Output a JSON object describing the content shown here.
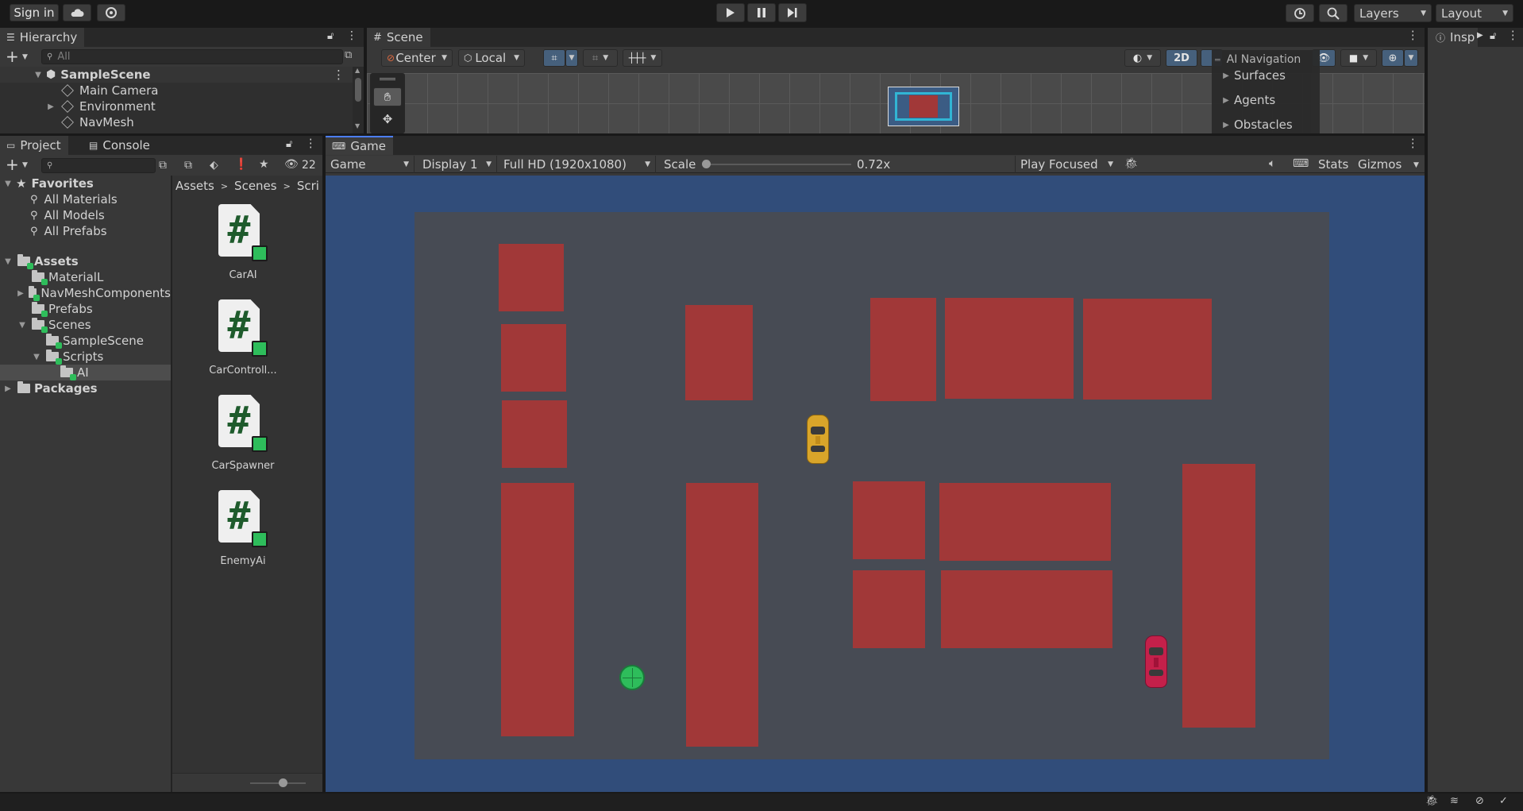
{
  "topbar": {
    "sign_in": "Sign in",
    "layers": "Layers",
    "layout": "Layout"
  },
  "hierarchy": {
    "tab": "Hierarchy",
    "search_placeholder": "All",
    "items": [
      {
        "label": "SampleScene"
      },
      {
        "label": "Main Camera"
      },
      {
        "label": "Environment"
      },
      {
        "label": "NavMesh"
      }
    ]
  },
  "scene": {
    "tab": "Scene",
    "pivot": "Center",
    "space": "Local",
    "mode_2d": "2D",
    "overlay": {
      "title": "AI Navigation",
      "items": [
        "Surfaces",
        "Agents",
        "Obstacles"
      ]
    }
  },
  "inspector": {
    "tab": "Insp"
  },
  "project": {
    "tab_project": "Project",
    "tab_console": "Console",
    "hidden_count": "22",
    "favorites": {
      "label": "Favorites",
      "items": [
        "All Materials",
        "All Models",
        "All Prefabs"
      ]
    },
    "assets_label": "Assets",
    "assets_items": [
      "MaterialL",
      "NavMeshComponents",
      "Prefabs",
      "Scenes",
      "SampleScene",
      "Scripts",
      "AI"
    ],
    "packages_label": "Packages",
    "breadcrumb": [
      "Assets",
      "Scenes",
      "Scrip"
    ],
    "files": [
      "CarAI",
      "CarControll...",
      "CarSpawner",
      "EnemyAi"
    ]
  },
  "game": {
    "tab": "Game",
    "view_mode": "Game",
    "display": "Display 1",
    "resolution": "Full HD (1920x1080)",
    "scale_label": "Scale",
    "scale_value": "0.72x",
    "scale_fraction": 0.0,
    "play_mode": "Play Focused",
    "stats": "Stats",
    "gizmos": "Gizmos"
  },
  "colors": {
    "accent": "#4c7eff",
    "obstacle": "#a13838",
    "ground": "#474b54",
    "sky": "#314d7a",
    "target": "#2ebd5b",
    "player_car": "#d9a52a",
    "enemy_car": "#c4204a"
  }
}
